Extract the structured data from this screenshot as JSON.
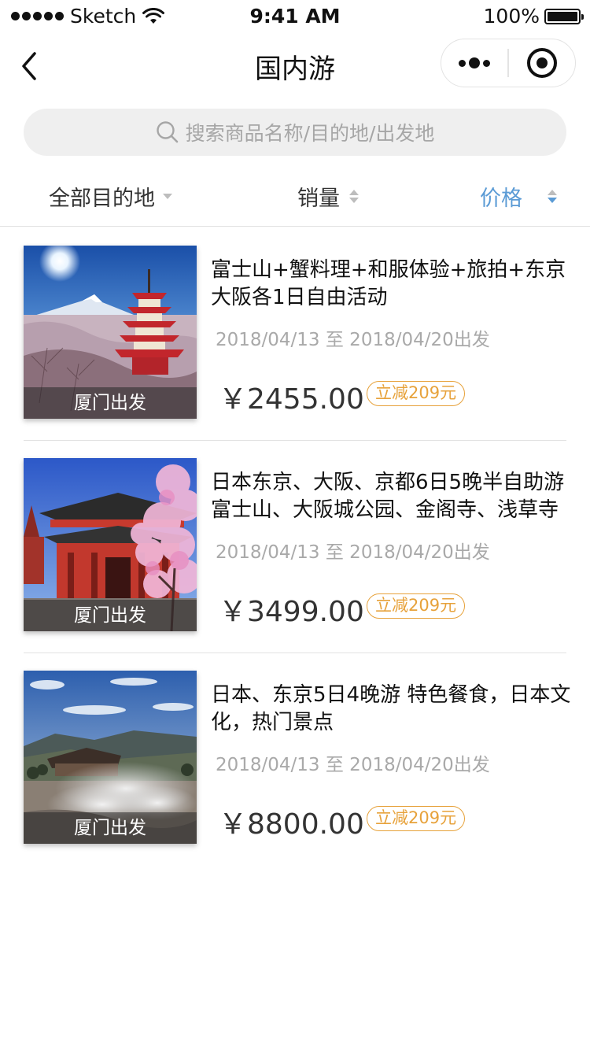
{
  "status_bar": {
    "carrier": "Sketch",
    "time": "9:41 AM",
    "battery": "100%"
  },
  "nav": {
    "title": "国内游"
  },
  "search": {
    "placeholder": "搜索商品名称/目的地/出发地"
  },
  "filters": {
    "destination": "全部目的地",
    "sales": "销量",
    "price": "价格",
    "active_color": "#5b9bd5"
  },
  "products": [
    {
      "title": "富士山+蟹料理+和服体验+旅拍+东京大阪各1日自由活动",
      "departure_tag": "厦门出发",
      "dates": "2018/04/13 至 2018/04/20出发",
      "price": "￥2455.00",
      "discount": "立减209元",
      "image": "pagoda-fuji"
    },
    {
      "title": "日本东京、大阪、京都6日5晚半自助游　富士山、大阪城公园、金阁寺、浅草寺",
      "departure_tag": "厦门出发",
      "dates": "2018/04/13 至 2018/04/20出发",
      "price": "￥3499.00",
      "discount": "立减209元",
      "image": "temple-sakura"
    },
    {
      "title": "日本、东京5日4晚游 特色餐食，日本文化，热门景点",
      "departure_tag": "厦门出发",
      "dates": "2018/04/13 至 2018/04/20出发",
      "price": "￥8800.00",
      "discount": "立减209元",
      "image": "hot-spring-valley"
    }
  ],
  "colors": {
    "discount": "#e7a23b",
    "divider": "#e2e2e2"
  }
}
